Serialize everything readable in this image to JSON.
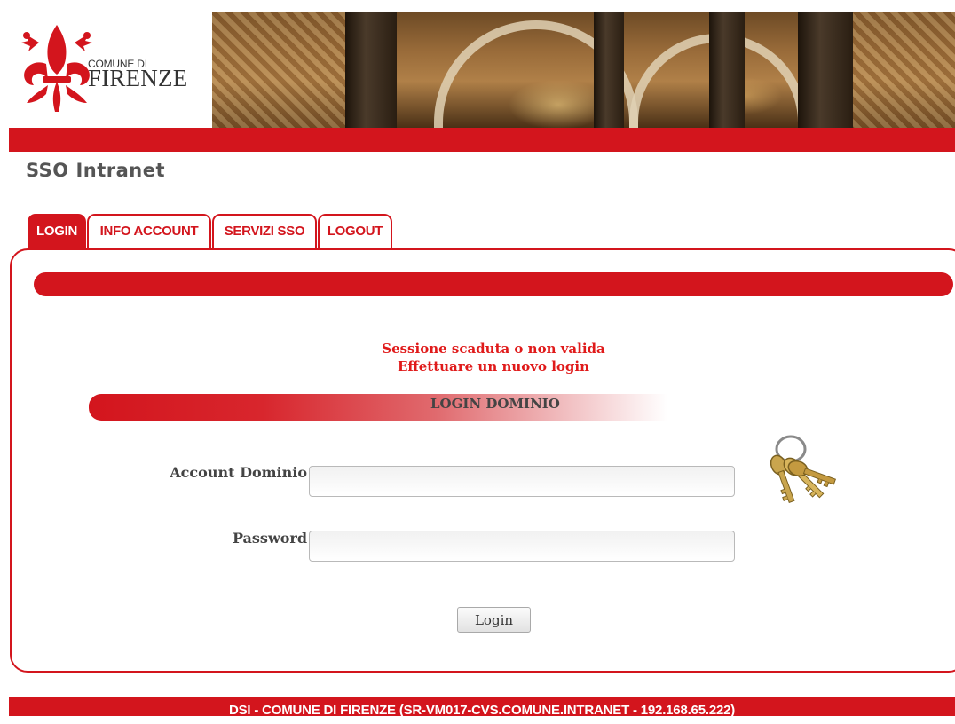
{
  "logo": {
    "line1": "COMUNE DI",
    "line2": "FIRENZE"
  },
  "site_title": "SSO Intranet",
  "tabs": [
    {
      "label": "LOGIN",
      "active": true
    },
    {
      "label": "INFO ACCOUNT",
      "active": false
    },
    {
      "label": "SERVIZI SSO",
      "active": false
    },
    {
      "label": "LOGOUT",
      "active": false
    }
  ],
  "message": {
    "line1": "Sessione scaduta o non valida",
    "line2": "Effettuare un nuovo login"
  },
  "login_section": {
    "title": "LOGIN DOMINIO",
    "account_label": "Account Dominio",
    "account_value": "",
    "password_label": "Password",
    "password_value": "",
    "button_label": "Login"
  },
  "footer": "DSI - COMUNE DI FIRENZE (SR-VM017-CVS.COMUNE.INTRANET - 192.168.65.222)",
  "colors": {
    "brand_red": "#d3151d",
    "message_red": "#e01a1a"
  }
}
